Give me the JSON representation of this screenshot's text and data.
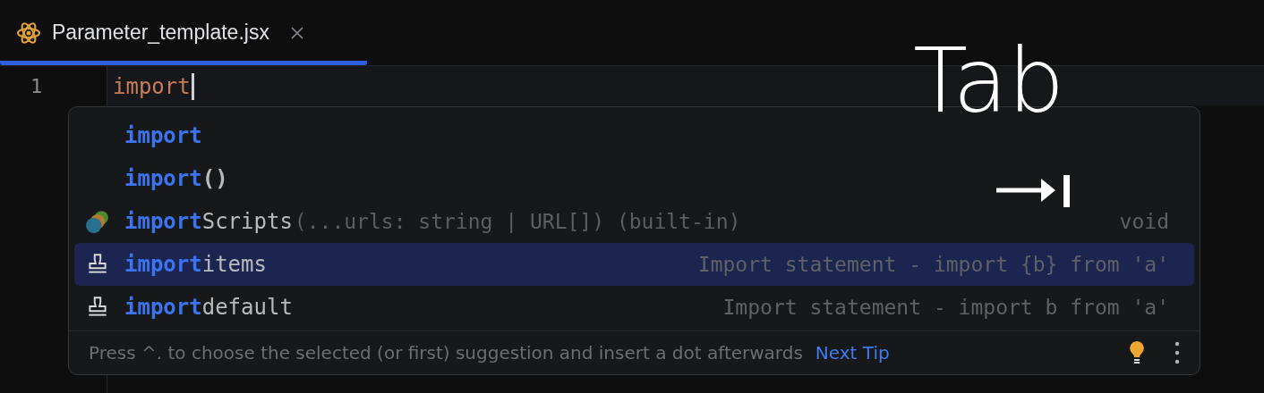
{
  "tabs": [
    {
      "label": "Parameter_template.jsx",
      "selected": true
    }
  ],
  "editor": {
    "line_number": "1",
    "code": "import"
  },
  "completion": {
    "items": [
      {
        "kind": "keyword",
        "match": "import",
        "selected": false
      },
      {
        "kind": "keyword",
        "match": "import",
        "rest": "()",
        "selected": false
      },
      {
        "kind": "function",
        "match": "import",
        "rest": "Scripts",
        "tail": "(...urls: string | URL[]) (built-in)",
        "detail": "void",
        "selected": false
      },
      {
        "kind": "template",
        "match": "import",
        "rest": "items",
        "detail": "Import statement - import {b} from 'a'",
        "selected": true
      },
      {
        "kind": "template",
        "match": "import",
        "rest": "default",
        "detail": "Import statement - import b from 'a'",
        "selected": false
      }
    ],
    "tip": "Press ^. to choose the selected (or first) suggestion and insert a dot afterwards",
    "tip_link": "Next Tip"
  },
  "overlay": {
    "key_label": "Tab"
  }
}
